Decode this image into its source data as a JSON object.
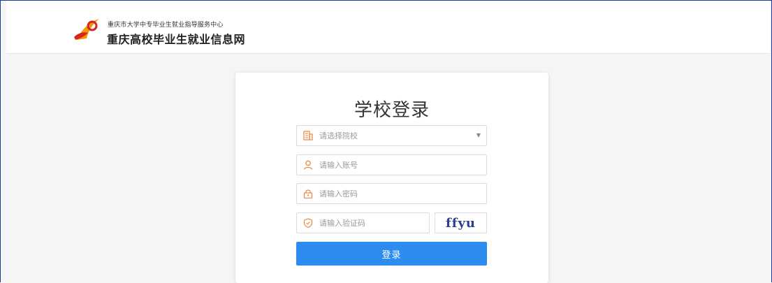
{
  "brand": {
    "subtitle": "重庆市大学中专毕业生就业指导服务中心",
    "title": "重庆高校毕业生就业信息网"
  },
  "login": {
    "title": "学校登录",
    "school_placeholder": "请选择院校",
    "account_placeholder": "请输入账号",
    "password_placeholder": "请输入密码",
    "captcha_placeholder": "请输入验证码",
    "captcha_text": "ffyu",
    "submit_label": "登录"
  },
  "colors": {
    "accent": "#2d8cf0",
    "icon": "#f08a4b",
    "logo_orange": "#f39800",
    "logo_red": "#d7261e"
  },
  "icons": {
    "school": "building-icon",
    "account": "user-icon",
    "password": "lock-icon",
    "captcha": "shield-icon",
    "dropdown": "caret-down-icon"
  }
}
